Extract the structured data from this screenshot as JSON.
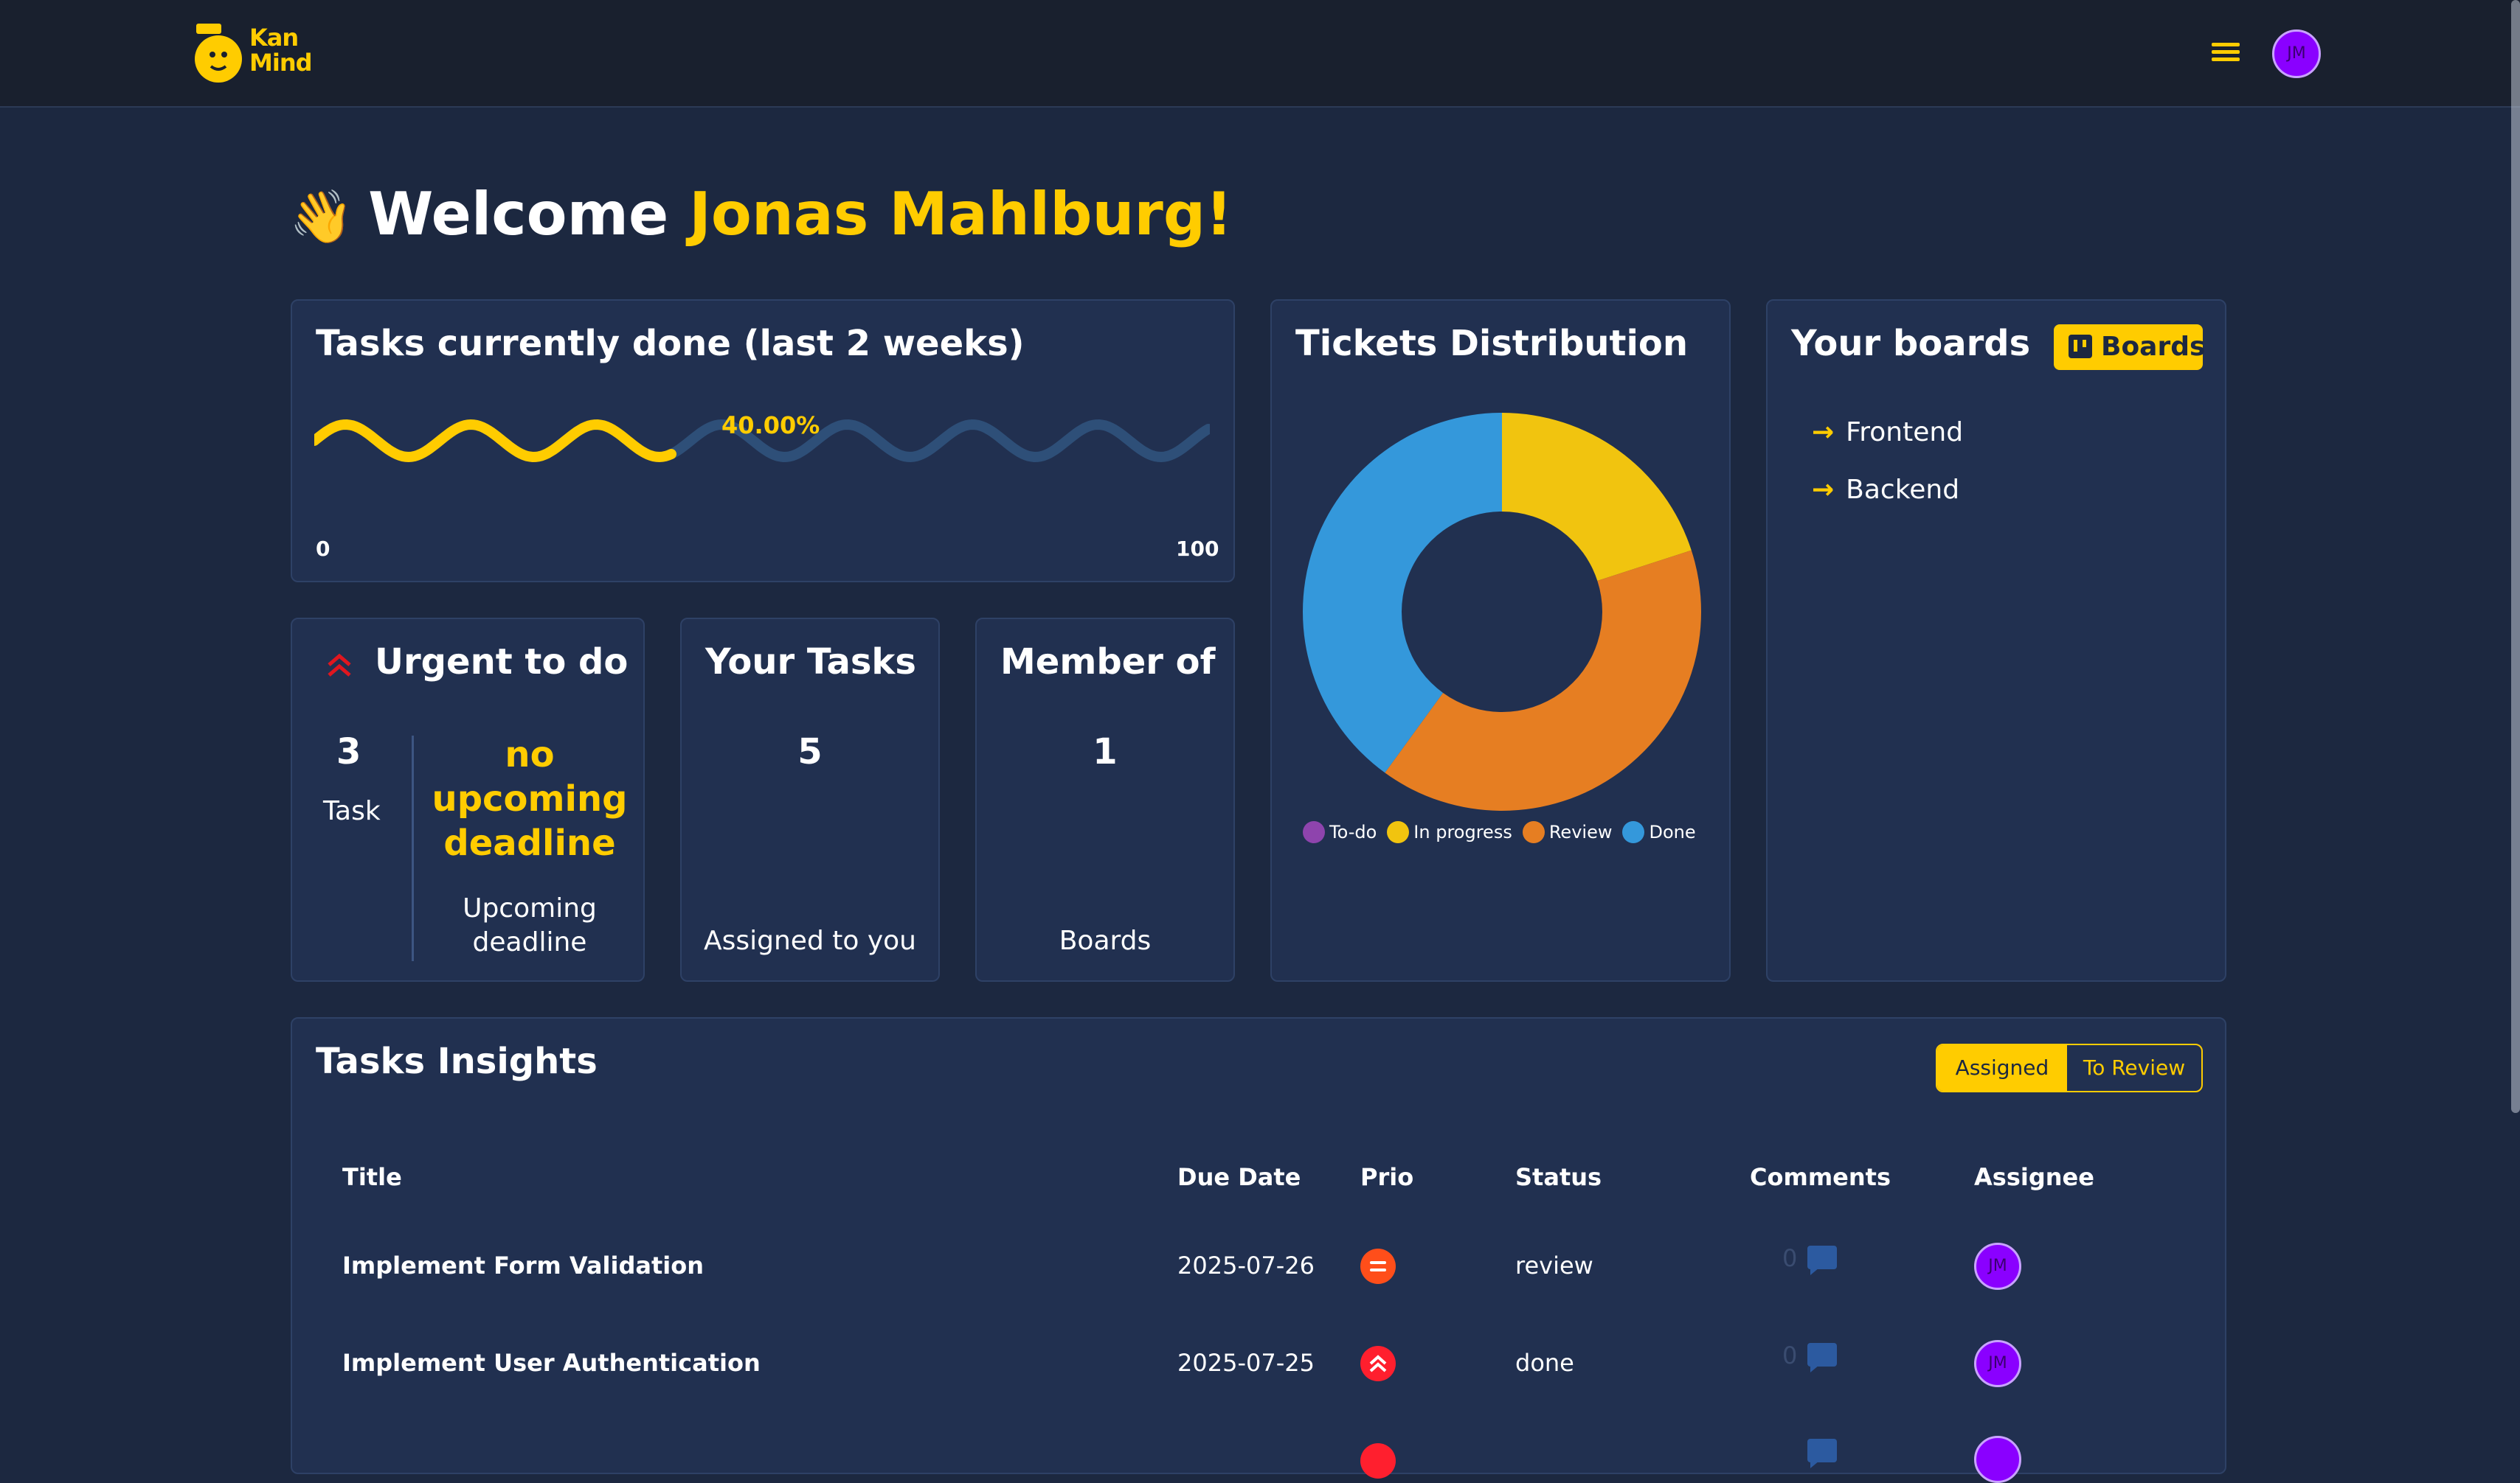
{
  "app": {
    "logo_text_line1": "Kan",
    "logo_text_line2": "Mind",
    "user_initials": "JM"
  },
  "welcome": {
    "wave": "👋",
    "greeting": "Welcome",
    "user_name": "Jonas Mahlburg!"
  },
  "progress": {
    "title": "Tasks currently done (last 2 weeks)",
    "percent_label": "40.00%",
    "value": 0.4,
    "min_label": "0",
    "max_label": "100",
    "colors": {
      "done": "#ffcc00",
      "remaining": "#2e4f78"
    }
  },
  "urgent": {
    "title": "Urgent to do",
    "count": "3",
    "count_label": "Task",
    "deadline_value": "no upcoming deadline",
    "deadline_label": "Upcoming deadline"
  },
  "your_tasks": {
    "title": "Your Tasks",
    "count": "5",
    "label": "Assigned to you"
  },
  "member_of": {
    "title": "Member of",
    "count": "1",
    "label": "Boards"
  },
  "distribution": {
    "title": "Tickets Distribution",
    "legend": [
      {
        "label": "To-do",
        "color": "#8e44ad"
      },
      {
        "label": "In progress",
        "color": "#f1c40f"
      },
      {
        "label": "Review",
        "color": "#e67e22"
      },
      {
        "label": "Done",
        "color": "#3498db"
      }
    ]
  },
  "chart_data": {
    "type": "pie",
    "title": "",
    "categories": [
      "To-do",
      "In progress",
      "Review",
      "Done"
    ],
    "values": [
      0,
      1,
      2,
      2
    ],
    "colors": [
      "#8e44ad",
      "#f1c40f",
      "#e67e22",
      "#3498db"
    ],
    "donut": true,
    "legend_position": "bottom"
  },
  "boards": {
    "title": "Your boards",
    "button_label": "Boards",
    "items": [
      "Frontend",
      "Backend"
    ]
  },
  "insights": {
    "title": "Tasks Insights",
    "toggle": {
      "active": "Assigned",
      "inactive": "To Review"
    },
    "columns": [
      "Title",
      "Due Date",
      "Prio",
      "Status",
      "Comments",
      "Assignee"
    ],
    "rows": [
      {
        "title": "Implement Form Validation",
        "due": "2025-07-26",
        "prio": "medium",
        "status": "review",
        "comments": "0",
        "assignee": "JM"
      },
      {
        "title": "Implement User Authentication",
        "due": "2025-07-25",
        "prio": "urgent",
        "status": "done",
        "comments": "0",
        "assignee": "JM"
      }
    ]
  }
}
